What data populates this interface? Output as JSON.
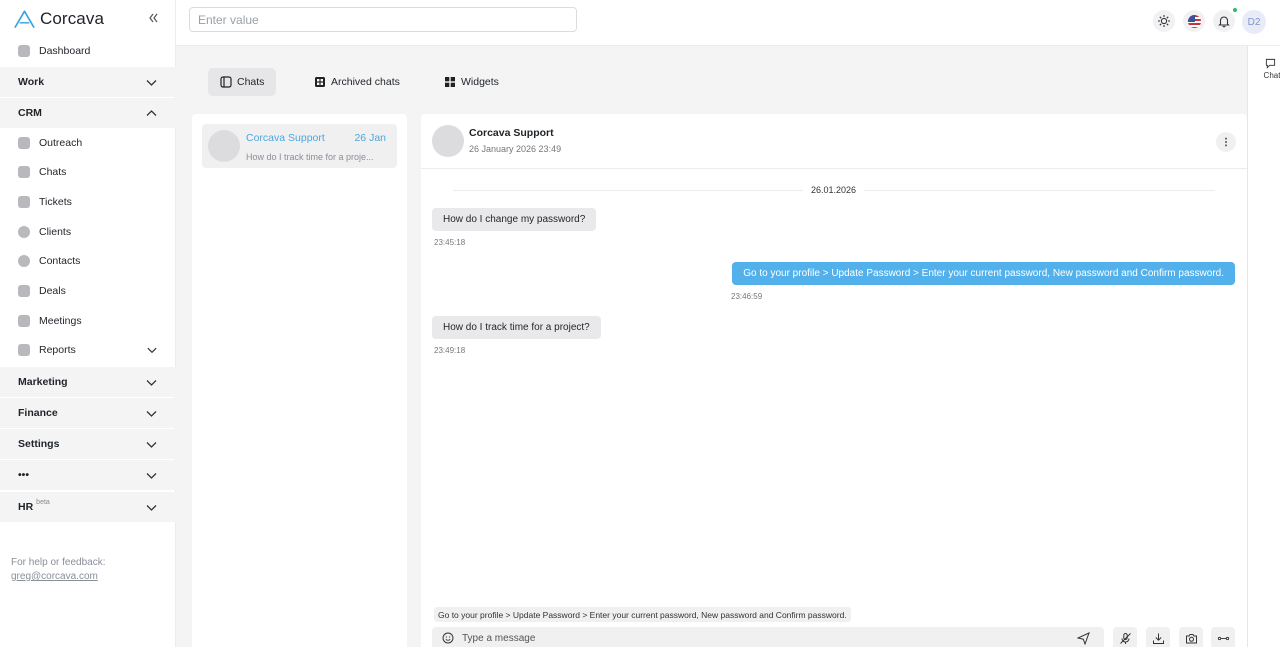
{
  "brand": {
    "name": "Corcava"
  },
  "sidebar": {
    "collapse_icon": "chevrons-left-icon",
    "dashboard": "Dashboard",
    "sections": {
      "work": "Work",
      "crm": "CRM",
      "marketing": "Marketing",
      "finance": "Finance",
      "settings": "Settings",
      "more": "•••",
      "hr": "HR",
      "hr_badge": "beta"
    },
    "crm_items": {
      "outreach": "Outreach",
      "chats": "Chats",
      "tickets": "Tickets",
      "clients": "Clients",
      "contacts": "Contacts",
      "deals": "Deals",
      "meetings": "Meetings",
      "reports": "Reports"
    },
    "help_text": "For help or feedback:",
    "help_email": "greg@corcava.com"
  },
  "topbar": {
    "search_placeholder": "Enter value",
    "avatar_initials": "D2",
    "icons": [
      "sun-icon",
      "us-flag-icon",
      "bell-icon"
    ],
    "notification_dot_color": "#2fba6a"
  },
  "rail": {
    "chat_label": "Chat"
  },
  "tabs": {
    "chats": "Chats",
    "archived": "Archived chats",
    "widgets": "Widgets"
  },
  "chat_list": [
    {
      "name": "Corcava Support",
      "date": "26 Jan",
      "preview": "How do I track time for a proje..."
    }
  ],
  "conversation": {
    "name": "Corcava Support",
    "date": "26 January 2026 23:49",
    "day": "26.01.2026",
    "messages": [
      {
        "direction": "in",
        "text": "How do I change my password?",
        "time": "23:45:18"
      },
      {
        "direction": "out",
        "text": "Go to your profile > Update Password > Enter your current password, New password and Confirm password.",
        "time": "23:46:59"
      },
      {
        "direction": "in",
        "text": "How do I track time for a project?",
        "time": "23:49:18"
      }
    ],
    "reply_preview": "Go to your profile > Update Password > Enter your current password, New password and Confirm password.",
    "composer_placeholder": "Type a message"
  },
  "colors": {
    "accent": "#52b1eb",
    "link": "#4aa7e0",
    "incoming_bubble": "#e9e9eb"
  }
}
